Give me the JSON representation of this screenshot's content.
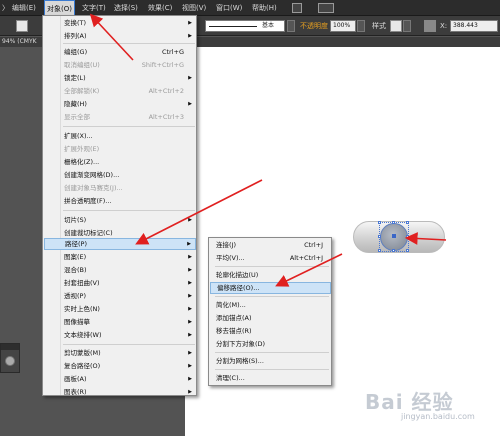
{
  "menubar": {
    "items": [
      {
        "label": "〉"
      },
      {
        "label": "编辑(E)"
      },
      {
        "label": "对象(O)"
      },
      {
        "label": "文字(T)"
      },
      {
        "label": "选择(S)"
      },
      {
        "label": "效果(C)"
      },
      {
        "label": "视图(V)"
      },
      {
        "label": "窗口(W)"
      },
      {
        "label": "帮助(H)"
      }
    ]
  },
  "controlbar": {
    "stroke_style": "基本",
    "opacity_label": "不透明度",
    "opacity_value": "100%",
    "style_label": "样式",
    "x_value": "388.443"
  },
  "document_tab": "94% (CMYK",
  "object_menu": {
    "items": [
      {
        "label": "变换(T)",
        "shortcut": "",
        "submenu": true,
        "disabled": false
      },
      {
        "label": "排列(A)",
        "shortcut": "",
        "submenu": true,
        "disabled": false
      },
      {
        "label": "编组(G)",
        "shortcut": "Ctrl+G",
        "submenu": false,
        "disabled": false
      },
      {
        "label": "取消编组(U)",
        "shortcut": "Shift+Ctrl+G",
        "submenu": false,
        "disabled": true
      },
      {
        "label": "锁定(L)",
        "shortcut": "",
        "submenu": true,
        "disabled": false
      },
      {
        "label": "全部解锁(K)",
        "shortcut": "Alt+Ctrl+2",
        "submenu": false,
        "disabled": true
      },
      {
        "label": "隐藏(H)",
        "shortcut": "",
        "submenu": true,
        "disabled": false
      },
      {
        "label": "显示全部",
        "shortcut": "Alt+Ctrl+3",
        "submenu": false,
        "disabled": true
      },
      {
        "label": "扩展(X)...",
        "shortcut": "",
        "submenu": false,
        "disabled": false
      },
      {
        "label": "扩展外观(E)",
        "shortcut": "",
        "submenu": false,
        "disabled": true
      },
      {
        "label": "栅格化(Z)...",
        "shortcut": "",
        "submenu": false,
        "disabled": false
      },
      {
        "label": "创建渐变网格(D)...",
        "shortcut": "",
        "submenu": false,
        "disabled": false
      },
      {
        "label": "创建对象马赛克(J)...",
        "shortcut": "",
        "submenu": false,
        "disabled": true
      },
      {
        "label": "拼合透明度(F)...",
        "shortcut": "",
        "submenu": false,
        "disabled": false
      },
      {
        "label": "切片(S)",
        "shortcut": "",
        "submenu": true,
        "disabled": false
      },
      {
        "label": "创建裁切标记(C)",
        "shortcut": "",
        "submenu": false,
        "disabled": false
      },
      {
        "label": "路径(P)",
        "shortcut": "",
        "submenu": true,
        "disabled": false
      },
      {
        "label": "图案(E)",
        "shortcut": "",
        "submenu": true,
        "disabled": false
      },
      {
        "label": "混合(B)",
        "shortcut": "",
        "submenu": true,
        "disabled": false
      },
      {
        "label": "封套扭曲(V)",
        "shortcut": "",
        "submenu": true,
        "disabled": false
      },
      {
        "label": "透视(P)",
        "shortcut": "",
        "submenu": true,
        "disabled": false
      },
      {
        "label": "实时上色(N)",
        "shortcut": "",
        "submenu": true,
        "disabled": false
      },
      {
        "label": "图像描摹",
        "shortcut": "",
        "submenu": true,
        "disabled": false
      },
      {
        "label": "文本绕排(W)",
        "shortcut": "",
        "submenu": true,
        "disabled": false
      },
      {
        "label": "剪切蒙版(M)",
        "shortcut": "",
        "submenu": true,
        "disabled": false
      },
      {
        "label": "复合路径(O)",
        "shortcut": "",
        "submenu": true,
        "disabled": false
      },
      {
        "label": "画板(A)",
        "shortcut": "",
        "submenu": true,
        "disabled": false
      },
      {
        "label": "图表(R)",
        "shortcut": "",
        "submenu": true,
        "disabled": false
      }
    ]
  },
  "path_submenu": {
    "items": [
      {
        "label": "连接(J)",
        "shortcut": "Ctrl+J"
      },
      {
        "label": "平均(V)...",
        "shortcut": "Alt+Ctrl+J"
      },
      {
        "label": "轮廓化描边(U)",
        "shortcut": ""
      },
      {
        "label": "偏移路径(O)...",
        "shortcut": ""
      },
      {
        "label": "简化(M)...",
        "shortcut": ""
      },
      {
        "label": "添加锚点(A)",
        "shortcut": ""
      },
      {
        "label": "移去锚点(R)",
        "shortcut": ""
      },
      {
        "label": "分割下方对象(D)",
        "shortcut": ""
      },
      {
        "label": "分割为网格(S)...",
        "shortcut": ""
      },
      {
        "label": "清理(C)...",
        "shortcut": ""
      }
    ]
  },
  "watermark": {
    "logo": "Bai 经验",
    "url": "jingyan.baidu.com"
  },
  "colors": {
    "menu_highlight": "#cde3f7",
    "annotation_red": "#e02020",
    "selection_blue": "#4a78d4"
  }
}
